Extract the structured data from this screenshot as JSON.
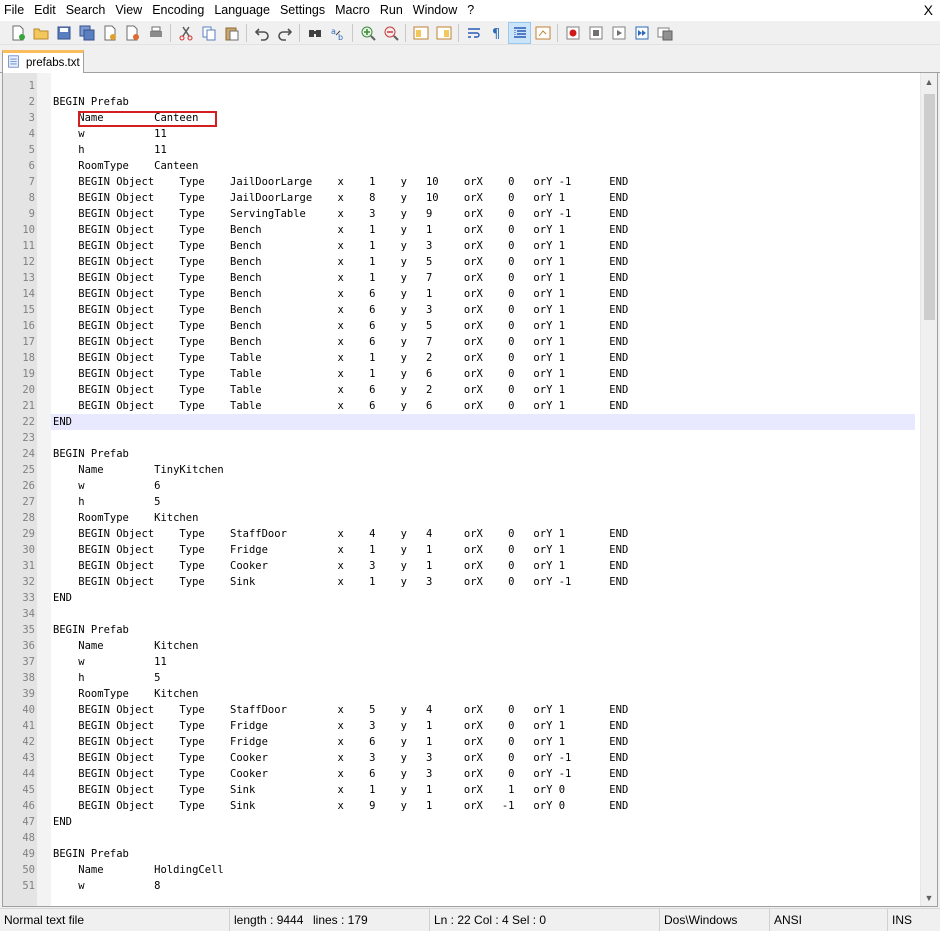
{
  "menu": {
    "items": [
      "File",
      "Edit",
      "Search",
      "View",
      "Encoding",
      "Language",
      "Settings",
      "Macro",
      "Run",
      "Window",
      "?"
    ],
    "close_label": "X"
  },
  "toolbar": {
    "buttons": [
      "new-file",
      "open-file",
      "save",
      "save-all",
      "close",
      "close-all",
      "print",
      "cut",
      "copy",
      "paste",
      "undo",
      "redo",
      "find",
      "replace",
      "zoom-in",
      "zoom-out",
      "sync-vertical",
      "sync-horizontal",
      "word-wrap",
      "show-all-characters",
      "indent-guide",
      "document-map",
      "record-macro",
      "stop-macro",
      "play-macro",
      "run-macro-multiple",
      "save-macro"
    ]
  },
  "tab": {
    "label": "prefabs.txt",
    "icon": "file-icon"
  },
  "editor": {
    "current_line": 22,
    "lines": [
      {
        "n": "1",
        "t": ""
      },
      {
        "n": "2",
        "t": "BEGIN Prefab"
      },
      {
        "n": "3",
        "t": "    Name        Canteen"
      },
      {
        "n": "4",
        "t": "    w           11"
      },
      {
        "n": "5",
        "t": "    h           11"
      },
      {
        "n": "6",
        "t": "    RoomType    Canteen"
      },
      {
        "n": "7",
        "t": "    BEGIN Object    Type    JailDoorLarge    x    1    y   10    orX    0   orY -1      END"
      },
      {
        "n": "8",
        "t": "    BEGIN Object    Type    JailDoorLarge    x    8    y   10    orX    0   orY 1       END"
      },
      {
        "n": "9",
        "t": "    BEGIN Object    Type    ServingTable     x    3    y   9     orX    0   orY -1      END"
      },
      {
        "n": "10",
        "t": "    BEGIN Object    Type    Bench            x    1    y   1     orX    0   orY 1       END"
      },
      {
        "n": "11",
        "t": "    BEGIN Object    Type    Bench            x    1    y   3     orX    0   orY 1       END"
      },
      {
        "n": "12",
        "t": "    BEGIN Object    Type    Bench            x    1    y   5     orX    0   orY 1       END"
      },
      {
        "n": "13",
        "t": "    BEGIN Object    Type    Bench            x    1    y   7     orX    0   orY 1       END"
      },
      {
        "n": "14",
        "t": "    BEGIN Object    Type    Bench            x    6    y   1     orX    0   orY 1       END"
      },
      {
        "n": "15",
        "t": "    BEGIN Object    Type    Bench            x    6    y   3     orX    0   orY 1       END"
      },
      {
        "n": "16",
        "t": "    BEGIN Object    Type    Bench            x    6    y   5     orX    0   orY 1       END"
      },
      {
        "n": "17",
        "t": "    BEGIN Object    Type    Bench            x    6    y   7     orX    0   orY 1       END"
      },
      {
        "n": "18",
        "t": "    BEGIN Object    Type    Table            x    1    y   2     orX    0   orY 1       END"
      },
      {
        "n": "19",
        "t": "    BEGIN Object    Type    Table            x    1    y   6     orX    0   orY 1       END"
      },
      {
        "n": "20",
        "t": "    BEGIN Object    Type    Table            x    6    y   2     orX    0   orY 1       END"
      },
      {
        "n": "21",
        "t": "    BEGIN Object    Type    Table            x    6    y   6     orX    0   orY 1       END"
      },
      {
        "n": "22",
        "t": "END"
      },
      {
        "n": "23",
        "t": ""
      },
      {
        "n": "24",
        "t": "BEGIN Prefab"
      },
      {
        "n": "25",
        "t": "    Name        TinyKitchen"
      },
      {
        "n": "26",
        "t": "    w           6"
      },
      {
        "n": "27",
        "t": "    h           5"
      },
      {
        "n": "28",
        "t": "    RoomType    Kitchen"
      },
      {
        "n": "29",
        "t": "    BEGIN Object    Type    StaffDoor        x    4    y   4     orX    0   orY 1       END"
      },
      {
        "n": "30",
        "t": "    BEGIN Object    Type    Fridge           x    1    y   1     orX    0   orY 1       END"
      },
      {
        "n": "31",
        "t": "    BEGIN Object    Type    Cooker           x    3    y   1     orX    0   orY 1       END"
      },
      {
        "n": "32",
        "t": "    BEGIN Object    Type    Sink             x    1    y   3     orX    0   orY -1      END"
      },
      {
        "n": "33",
        "t": "END"
      },
      {
        "n": "34",
        "t": ""
      },
      {
        "n": "35",
        "t": "BEGIN Prefab"
      },
      {
        "n": "36",
        "t": "    Name        Kitchen"
      },
      {
        "n": "37",
        "t": "    w           11"
      },
      {
        "n": "38",
        "t": "    h           5"
      },
      {
        "n": "39",
        "t": "    RoomType    Kitchen"
      },
      {
        "n": "40",
        "t": "    BEGIN Object    Type    StaffDoor        x    5    y   4     orX    0   orY 1       END"
      },
      {
        "n": "41",
        "t": "    BEGIN Object    Type    Fridge           x    3    y   1     orX    0   orY 1       END"
      },
      {
        "n": "42",
        "t": "    BEGIN Object    Type    Fridge           x    6    y   1     orX    0   orY 1       END"
      },
      {
        "n": "43",
        "t": "    BEGIN Object    Type    Cooker           x    3    y   3     orX    0   orY -1      END"
      },
      {
        "n": "44",
        "t": "    BEGIN Object    Type    Cooker           x    6    y   3     orX    0   orY -1      END"
      },
      {
        "n": "45",
        "t": "    BEGIN Object    Type    Sink             x    1    y   1     orX    1   orY 0       END"
      },
      {
        "n": "46",
        "t": "    BEGIN Object    Type    Sink             x    9    y   1     orX   -1   orY 0       END"
      },
      {
        "n": "47",
        "t": "END"
      },
      {
        "n": "48",
        "t": ""
      },
      {
        "n": "49",
        "t": "BEGIN Prefab"
      },
      {
        "n": "50",
        "t": "    Name        HoldingCell"
      },
      {
        "n": "51",
        "t": "    w           8"
      }
    ]
  },
  "status": {
    "file_type": "Normal text file",
    "length": "length : 9444",
    "lines": "lines : 179",
    "position": "Ln : 22    Col : 4    Sel : 0",
    "eol": "Dos\\Windows",
    "encoding": "ANSI",
    "mode": "INS"
  }
}
